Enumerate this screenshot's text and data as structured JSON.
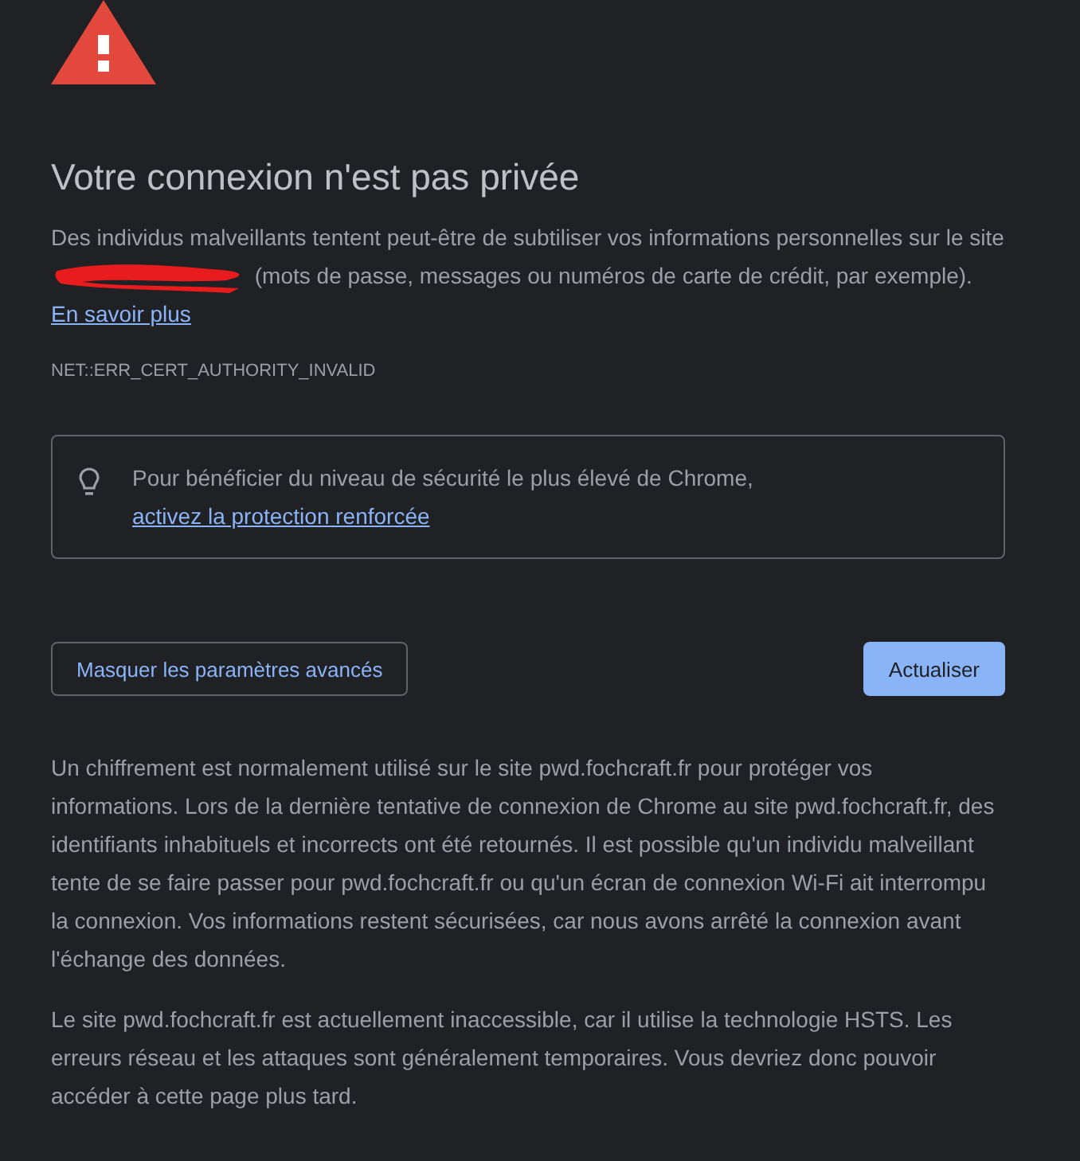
{
  "title": "Votre connexion n'est pas privée",
  "intro": {
    "before": "Des individus malveillants tentent peut-être de subtiliser vos informations personnelles sur le site",
    "after": "(mots de passe, messages ou numéros de carte de crédit, par exemple).",
    "link": "En savoir plus"
  },
  "error_code": "NET::ERR_CERT_AUTHORITY_INVALID",
  "tip": {
    "text": "Pour bénéficier du niveau de sécurité le plus élevé de Chrome,",
    "link": "activez la protection renforcée"
  },
  "buttons": [
    {
      "label": "Masquer les paramètres avancés",
      "kind": "secondary"
    },
    {
      "label": "Actualiser",
      "kind": "primary"
    }
  ],
  "details": [
    "Un chiffrement est normalement utilisé sur le site pwd.fochcraft.fr pour protéger vos informations. Lors de la dernière tentative de connexion de Chrome au site pwd.fochcraft.fr, des identifiants inhabituels et incorrects ont été retournés. Il est possible qu'un individu malveillant tente de se faire passer pour pwd.fochcraft.fr ou qu'un écran de connexion Wi-Fi ait interrompu la connexion. Vos informations restent sécurisées, car nous avons arrêté la connexion avant l'échange des données.",
    "Le site pwd.fochcraft.fr est actuellement inaccessible, car il utilise la technologie HSTS. Les erreurs réseau et les attaques sont généralement temporaires. Vous devriez donc pouvoir accéder à cette page plus tard."
  ]
}
